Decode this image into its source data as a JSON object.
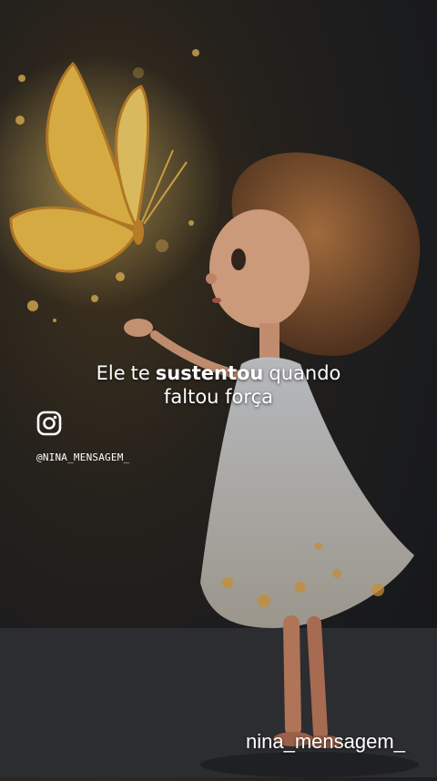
{
  "caption": {
    "word_1": "Ele",
    "word_2": "te",
    "word_3": "sustentou",
    "word_4": "quando",
    "line_2": "faltou força"
  },
  "social": {
    "icon": "instagram-icon",
    "handle_top": "@NINA_MENSAGEM_",
    "handle_bottom": "nina_mensagem_"
  },
  "colors": {
    "butterfly": "#f3c24d",
    "glow": "#ffdc7a",
    "text": "#ffffff"
  }
}
